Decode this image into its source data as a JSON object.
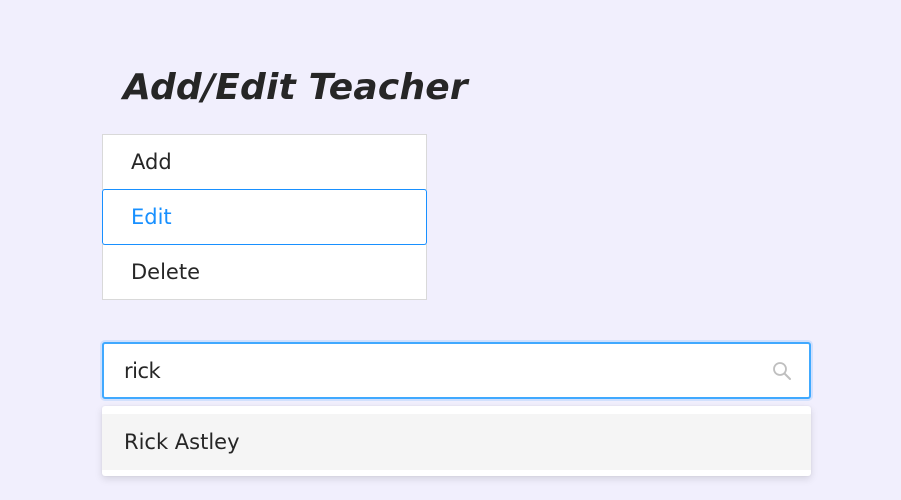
{
  "header": {
    "title": "Add/Edit Teacher"
  },
  "mode_selector": {
    "options": [
      {
        "label": "Add"
      },
      {
        "label": "Edit"
      },
      {
        "label": "Delete"
      }
    ],
    "selected": "Edit"
  },
  "search": {
    "value": "rick",
    "icon": "search-icon"
  },
  "dropdown": {
    "options": [
      {
        "label": "Rick Astley"
      }
    ]
  },
  "colors": {
    "background": "#f1effd",
    "accent": "#1890ff",
    "text": "#262626"
  }
}
